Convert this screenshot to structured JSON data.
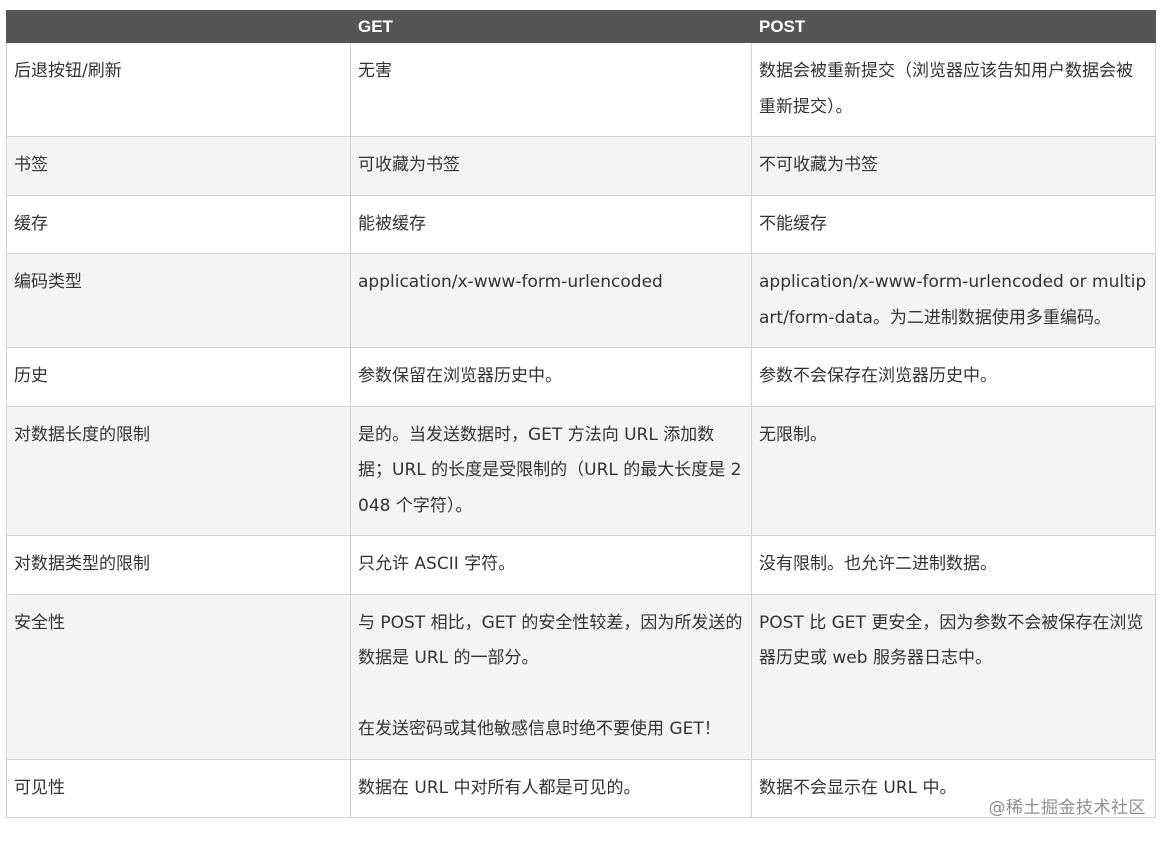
{
  "table": {
    "headers": [
      "",
      "GET",
      "POST"
    ],
    "rows": [
      {
        "label": "后退按钮/刷新",
        "get": "无害",
        "post": "数据会被重新提交（浏览器应该告知用户数据会被重新提交）。"
      },
      {
        "label": "书签",
        "get": "可收藏为书签",
        "post": "不可收藏为书签"
      },
      {
        "label": "缓存",
        "get": "能被缓存",
        "post": "不能缓存"
      },
      {
        "label": "编码类型",
        "get": "application/x-www-form-urlencoded",
        "post": "application/x-www-form-urlencoded or multipart/form-data。为二进制数据使用多重编码。"
      },
      {
        "label": "历史",
        "get": "参数保留在浏览器历史中。",
        "post": "参数不会保存在浏览器历史中。"
      },
      {
        "label": "对数据长度的限制",
        "get": "是的。当发送数据时，GET 方法向 URL 添加数据；URL 的长度是受限制的（URL 的最大长度是 2048 个字符）。",
        "post": "无限制。"
      },
      {
        "label": "对数据类型的限制",
        "get": "只允许 ASCII 字符。",
        "post": "没有限制。也允许二进制数据。"
      },
      {
        "label": "安全性",
        "get": "与 POST 相比，GET 的安全性较差，因为所发送的数据是 URL 的一部分。",
        "get_note": "在发送密码或其他敏感信息时绝不要使用 GET！",
        "post": "POST 比 GET 更安全，因为参数不会被保存在浏览器历史或 web 服务器日志中。"
      },
      {
        "label": "可见性",
        "get": "数据在 URL 中对所有人都是可见的。",
        "post": "数据不会显示在 URL 中。"
      }
    ]
  },
  "watermark": "@稀土掘金技术社区",
  "colors": {
    "header_bg": "#555555",
    "header_text": "#ffffff",
    "row_alt_bg": "#f6f4f0",
    "border": "#d4d4d4",
    "text": "#333333"
  }
}
